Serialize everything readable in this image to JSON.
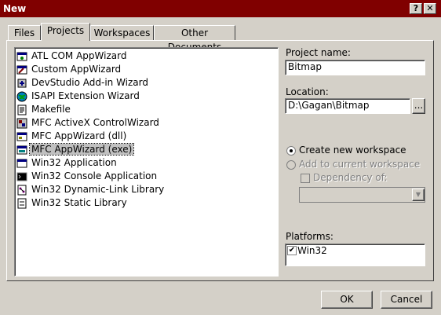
{
  "window": {
    "title": "New",
    "help_glyph": "?",
    "close_glyph": "✕"
  },
  "tabs": [
    {
      "label": "Files"
    },
    {
      "label": "Projects"
    },
    {
      "label": "Workspaces"
    },
    {
      "label": "Other Documents"
    }
  ],
  "project_types": [
    {
      "label": "ATL COM AppWizard",
      "icon": "atl-com-appwizard-icon"
    },
    {
      "label": "Custom AppWizard",
      "icon": "custom-appwizard-icon"
    },
    {
      "label": "DevStudio Add-in Wizard",
      "icon": "devstudio-addin-icon"
    },
    {
      "label": "ISAPI Extension Wizard",
      "icon": "isapi-globe-icon"
    },
    {
      "label": "Makefile",
      "icon": "makefile-icon"
    },
    {
      "label": "MFC ActiveX ControlWizard",
      "icon": "mfc-activex-icon"
    },
    {
      "label": "MFC AppWizard (dll)",
      "icon": "mfc-dll-icon"
    },
    {
      "label": "MFC AppWizard (exe)",
      "icon": "mfc-exe-icon",
      "selected": true
    },
    {
      "label": "Win32 Application",
      "icon": "win32-app-icon"
    },
    {
      "label": "Win32 Console Application",
      "icon": "console-app-icon"
    },
    {
      "label": "Win32 Dynamic-Link Library",
      "icon": "dll-icon"
    },
    {
      "label": "Win32 Static Library",
      "icon": "static-lib-icon"
    }
  ],
  "project_name": {
    "label": "Project name:",
    "value": "Bitmap"
  },
  "location": {
    "label": "Location:",
    "value": "D:\\Gagan\\Bitmap",
    "browse": "..."
  },
  "workspace": {
    "create_new": "Create new workspace",
    "add_current": "Add to current workspace",
    "dependency_of": "Dependency of:"
  },
  "platforms": {
    "label": "Platforms:",
    "items": [
      {
        "label": "Win32",
        "checked": true
      }
    ]
  },
  "buttons": {
    "ok": "OK",
    "cancel": "Cancel"
  }
}
